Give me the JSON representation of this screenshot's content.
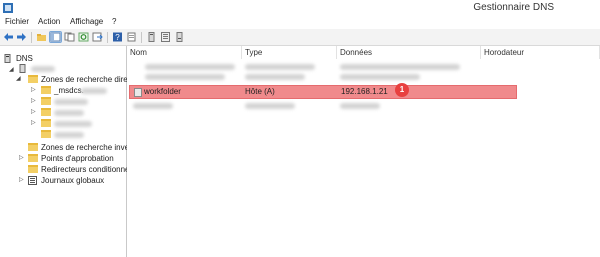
{
  "window": {
    "title": "Gestionnaire DNS"
  },
  "menu": [
    "Fichier",
    "Action",
    "Affichage",
    "?"
  ],
  "toolbar": {
    "icons": [
      "back-icon",
      "forward-icon",
      "folder-up-icon",
      "console-tree-icon",
      "copy-icon",
      "refresh-icon",
      "export-icon",
      "help-icon",
      "server-icon",
      "list-icon",
      "properties-icon"
    ]
  },
  "tree": {
    "root": "DNS",
    "forward_zones": "Zones de recherche direc",
    "msdcs": "_msdcs.",
    "reverse_zones": "Zones de recherche inver",
    "trust_points": "Points d'approbation",
    "forwarders": "Redirecteurs conditionne",
    "global_logs": "Journaux globaux"
  },
  "columns": {
    "name": "Nom",
    "type": "Type",
    "data": "Données",
    "timestamp": "Horodateur"
  },
  "highlighted_record": {
    "name": "workfolder",
    "type": "Hôte (A)",
    "data": "192.168.1.21",
    "timestamp": ""
  },
  "annotation": {
    "badge": "1"
  },
  "colors": {
    "highlight": "#f08a8c",
    "badge": "#e8403f"
  }
}
